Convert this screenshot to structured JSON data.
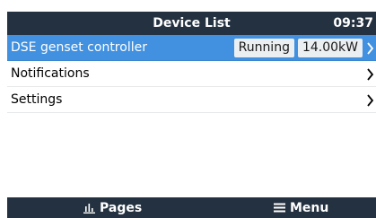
{
  "header": {
    "title": "Device List",
    "time": "09:37"
  },
  "list": {
    "items": [
      {
        "label": "DSE genset controller",
        "status": "Running",
        "power": "14.00kW",
        "selected": true
      },
      {
        "label": "Notifications"
      },
      {
        "label": "Settings"
      }
    ]
  },
  "footer": {
    "pages_label": "Pages",
    "menu_label": "Menu"
  },
  "colors": {
    "bar": "#243140",
    "selected": "#4191e0"
  },
  "icons": {
    "pages": "bar-chart-icon",
    "menu": "hamburger-menu-icon",
    "row": "chevron-right-icon"
  }
}
